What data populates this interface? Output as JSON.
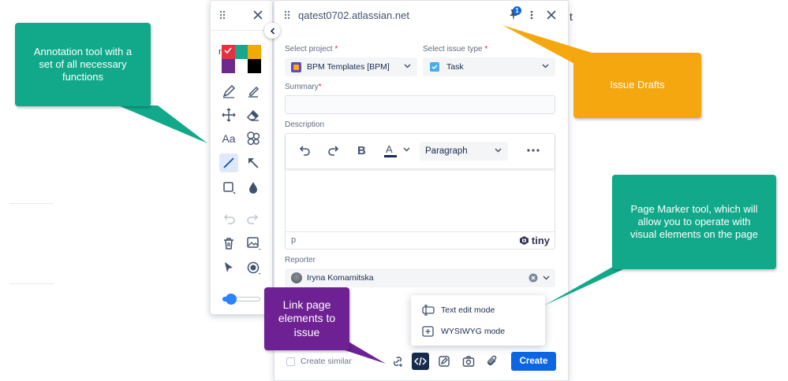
{
  "colors": {
    "callout_green": "#12a98a",
    "callout_orange": "#f5a70f",
    "callout_purple": "#6d2192",
    "primary_button": "#0c66e4",
    "swatches": [
      "#e5323f",
      "#1aa58c",
      "#f2a900",
      "#6b2a8c",
      "#ffffff",
      "#000000"
    ]
  },
  "annotation_toolbar": {
    "selected_swatch": 0,
    "tools": [
      "pen-icon",
      "highlighter-icon",
      "move-icon",
      "eraser-icon",
      "text-icon",
      "blur-icon",
      "line-icon",
      "arrow-icon",
      "rectangle-icon",
      "fill-drop-icon",
      "undo-icon",
      "redo-icon",
      "delete-icon",
      "image-icon",
      "pointer-icon",
      "record-icon"
    ],
    "active_tool": "line-icon",
    "stroke_size_fraction": 0.15
  },
  "issue_panel": {
    "site": "qatest0702.atlassian.net",
    "drafts_badge": "1",
    "project": {
      "label": "Select project",
      "required_mark": "*",
      "value": "BPM Templates [BPM]"
    },
    "issue_type": {
      "label": "Select issue type",
      "required_mark": "*",
      "value": "Task"
    },
    "summary": {
      "label": "Summary",
      "required_mark": "*",
      "value": ""
    },
    "description": {
      "label": "Description",
      "block_format": "Paragraph",
      "status_path": "p",
      "brand": "tiny"
    },
    "reporter": {
      "label": "Reporter",
      "value": "Iryna Komarnitska"
    },
    "mode_menu": {
      "items": [
        "Text edit mode",
        "WYSIWYG mode"
      ]
    },
    "footer": {
      "create_similar": "Create similar",
      "create_button": "Create"
    }
  },
  "callouts": {
    "annotation_tool": "Annotation tool with a set of all necessary functions",
    "issue_drafts": "Issue Drafts",
    "page_marker": "Page Marker tool, which will allow you to operate with visual elements on the page",
    "link_elements": "Link page elements to issue"
  }
}
